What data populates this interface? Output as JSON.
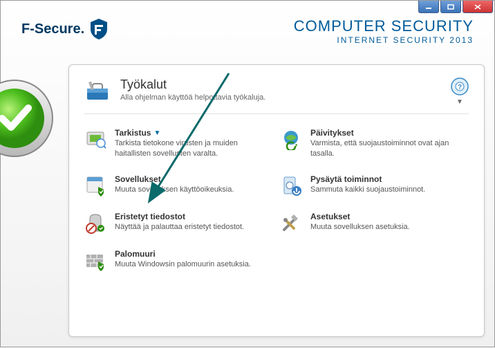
{
  "brand": {
    "name": "F-Secure."
  },
  "header": {
    "title": "COMPUTER SECURITY",
    "subtitle": "INTERNET SECURITY  2013"
  },
  "panel": {
    "title": "Työkalut",
    "subtitle": "Alla ohjelman käyttöä helpottavia työkaluja."
  },
  "tools": {
    "scan": {
      "title": "Tarkistus",
      "desc": "Tarkista tietokone virusten ja muiden haitallisten sovellusten varalta."
    },
    "updates": {
      "title": "Päivitykset",
      "desc": "Varmista, että suojaustoiminnot ovat ajan tasalla."
    },
    "apps": {
      "title": "Sovellukset",
      "desc": "Muuta sovelluksen käyttöoikeuksia."
    },
    "stop": {
      "title": "Pysäytä toiminnot",
      "desc": "Sammuta kaikki suojaustoiminnot."
    },
    "quarantine": {
      "title": "Eristetyt tiedostot",
      "desc": "Näyttää ja palauttaa eristetyt tiedostot."
    },
    "settings": {
      "title": "Asetukset",
      "desc": "Muuta sovelluksen asetuksia."
    },
    "firewall": {
      "title": "Palomuuri",
      "desc": "Muuta Windowsin palomuurin asetuksia."
    }
  }
}
